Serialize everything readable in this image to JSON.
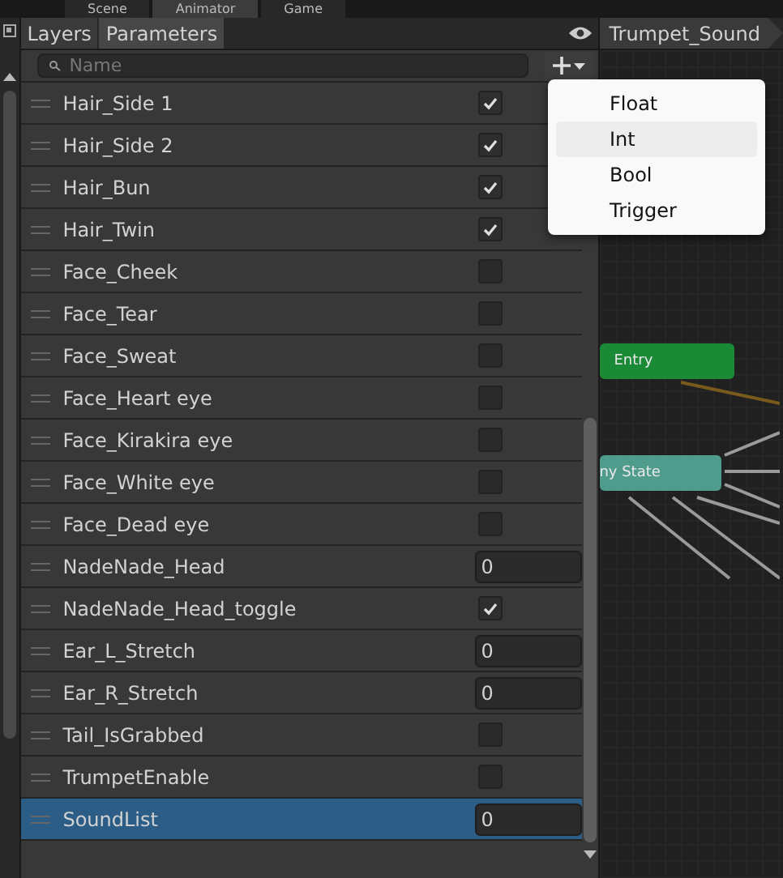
{
  "window_tabs": [
    {
      "label": "Scene",
      "selected": false
    },
    {
      "label": "Animator",
      "selected": true
    },
    {
      "label": "Game",
      "selected": false
    }
  ],
  "panel_tabs": [
    {
      "label": "Layers",
      "selected": false
    },
    {
      "label": "Parameters",
      "selected": true
    }
  ],
  "search": {
    "placeholder": "Name"
  },
  "breadcrumb": "Trumpet_Sound",
  "parameters": [
    {
      "name": "Hair_Side 1",
      "kind": "bool",
      "checked": true,
      "selected": false
    },
    {
      "name": "Hair_Side 2",
      "kind": "bool",
      "checked": true,
      "selected": false
    },
    {
      "name": "Hair_Bun",
      "kind": "bool",
      "checked": true,
      "selected": false
    },
    {
      "name": "Hair_Twin",
      "kind": "bool",
      "checked": true,
      "selected": false
    },
    {
      "name": "Face_Cheek",
      "kind": "bool",
      "checked": false,
      "selected": false
    },
    {
      "name": "Face_Tear",
      "kind": "bool",
      "checked": false,
      "selected": false
    },
    {
      "name": "Face_Sweat",
      "kind": "bool",
      "checked": false,
      "selected": false
    },
    {
      "name": "Face_Heart eye",
      "kind": "bool",
      "checked": false,
      "selected": false
    },
    {
      "name": "Face_Kirakira eye",
      "kind": "bool",
      "checked": false,
      "selected": false
    },
    {
      "name": "Face_White eye",
      "kind": "bool",
      "checked": false,
      "selected": false
    },
    {
      "name": "Face_Dead eye",
      "kind": "bool",
      "checked": false,
      "selected": false
    },
    {
      "name": "NadeNade_Head",
      "kind": "int",
      "value": "0",
      "selected": false
    },
    {
      "name": "NadeNade_Head_toggle",
      "kind": "bool",
      "checked": true,
      "selected": false
    },
    {
      "name": "Ear_L_Stretch",
      "kind": "int",
      "value": "0",
      "selected": false
    },
    {
      "name": "Ear_R_Stretch",
      "kind": "int",
      "value": "0",
      "selected": false
    },
    {
      "name": "Tail_IsGrabbed",
      "kind": "bool",
      "checked": false,
      "selected": false
    },
    {
      "name": "TrumpetEnable",
      "kind": "bool",
      "checked": false,
      "selected": false
    },
    {
      "name": "SoundList",
      "kind": "int",
      "value": "0",
      "selected": true
    }
  ],
  "nodes": [
    {
      "label": "Entry",
      "kind": "entry"
    },
    {
      "label": "ny State",
      "kind": "any"
    }
  ],
  "add_menu": [
    {
      "label": "Float",
      "selected": false
    },
    {
      "label": "Int",
      "selected": true
    },
    {
      "label": "Bool",
      "selected": false
    },
    {
      "label": "Trigger",
      "selected": false
    }
  ]
}
